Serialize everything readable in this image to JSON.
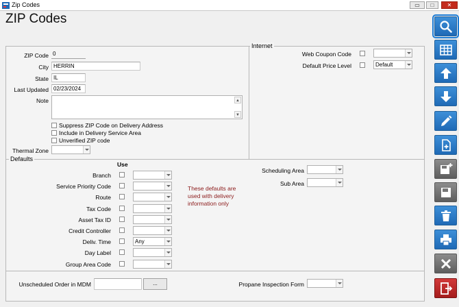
{
  "window": {
    "title": "Zip Codes",
    "minimize": "▭",
    "restore": "□",
    "close": "✕"
  },
  "page_title": "ZIP Codes",
  "main": {
    "zip_code_label": "ZIP Code",
    "zip_code_value": "0",
    "city_label": "City",
    "city_value": "HERRIN",
    "state_label": "State",
    "state_value": "IL",
    "last_updated_label": "Last Updated",
    "last_updated_value": "02/23/2024",
    "note_label": "Note",
    "suppress_label": "Suppress ZIP Code on Delivery Address",
    "include_label": "Include in Delivery Service Area",
    "unverified_label": "Unverified ZIP code",
    "thermal_zone_label": "Thermal Zone"
  },
  "internet": {
    "section_label": "Internet",
    "web_coupon_label": "Web Coupon Code",
    "default_price_label": "Default Price Level",
    "default_price_value": "Default"
  },
  "defaults": {
    "section_label": "Defaults",
    "use_header": "Use",
    "rows": [
      {
        "label": "Branch",
        "value": ""
      },
      {
        "label": "Service Priority Code",
        "value": ""
      },
      {
        "label": "Route",
        "value": ""
      },
      {
        "label": "Tax Code",
        "value": ""
      },
      {
        "label": "Asset Tax ID",
        "value": ""
      },
      {
        "label": "Credit Controller",
        "value": ""
      },
      {
        "label": "Deliv. Time",
        "value": "Any"
      },
      {
        "label": "Day Label",
        "value": ""
      },
      {
        "label": "Group Area Code",
        "value": ""
      }
    ],
    "info_line1": "These defaults are",
    "info_line2": "used with delivery",
    "info_line3": "information only",
    "scheduling_area_label": "Scheduling Area",
    "sub_area_label": "Sub Area"
  },
  "bottom": {
    "unscheduled_label": "Unscheduled Order in MDM",
    "ellipsis": "...",
    "propane_label": "Propane Inspection Form"
  },
  "colors": {
    "accent": "#1f6ab6",
    "info_text": "#8b1a1a",
    "exit": "#a51c1c"
  },
  "toolbar_icons": [
    "search-icon",
    "grid-icon",
    "arrow-up-icon",
    "arrow-down-icon",
    "pencil-icon",
    "new-document-icon",
    "save-new-icon",
    "save-icon",
    "trash-icon",
    "print-icon",
    "cancel-icon",
    "exit-icon"
  ]
}
